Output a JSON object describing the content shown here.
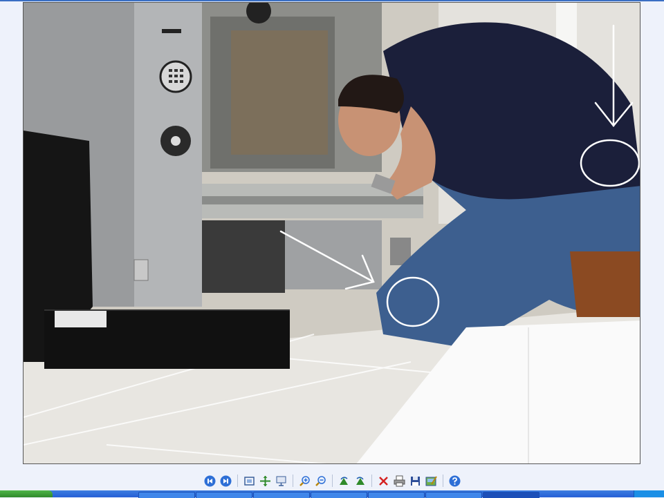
{
  "viewer": {
    "photo_description_hidden": null,
    "toolbar": [
      {
        "name": "previous-image-button",
        "icon": "previous-icon",
        "color": "#2e6fd6"
      },
      {
        "name": "next-image-button",
        "icon": "next-icon",
        "color": "#2e6fd6"
      },
      {
        "name": "best-fit-button",
        "icon": "best-fit-icon",
        "color": "#3a5f9a"
      },
      {
        "name": "actual-size-button",
        "icon": "actual-size-icon",
        "color": "#2f8a2a"
      },
      {
        "name": "slideshow-button",
        "icon": "slideshow-icon",
        "color": "#3a5f9a"
      },
      {
        "name": "zoom-in-button",
        "icon": "zoom-in-icon",
        "color": "#2e6fd6"
      },
      {
        "name": "zoom-out-button",
        "icon": "zoom-out-icon",
        "color": "#2e6fd6"
      },
      {
        "name": "rotate-clockwise-button",
        "icon": "rotate-clockwise-icon",
        "color": "#2f8a2a"
      },
      {
        "name": "rotate-counterclockwise-button",
        "icon": "rotate-counterclockwise-icon",
        "color": "#2f8a2a"
      },
      {
        "name": "delete-button",
        "icon": "delete-icon",
        "color": "#d42020"
      },
      {
        "name": "print-button",
        "icon": "print-icon",
        "color": "#555555"
      },
      {
        "name": "save-button",
        "icon": "save-icon",
        "color": "#2e4f9a"
      },
      {
        "name": "open-with-button",
        "icon": "edit-image-icon",
        "color": "#2f8a2a"
      },
      {
        "name": "help-button",
        "icon": "help-icon",
        "color": "#2e6fd6"
      }
    ]
  },
  "colors": {
    "background": "#eef2fb",
    "taskbar": "#245ed6",
    "start": "#2f8a2a"
  }
}
